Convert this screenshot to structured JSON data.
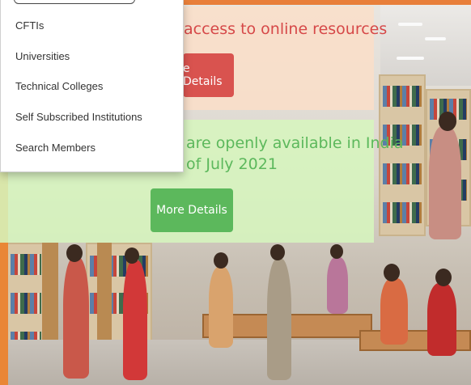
{
  "banners": [
    {
      "text": "access to online resources",
      "button_label": "e Details"
    },
    {
      "text_line1": "are openly available in India",
      "text_line2": "of July 2021",
      "button_label": "More Details"
    }
  ],
  "menu": {
    "items": [
      "CFTIs",
      "Universities",
      "Technical Colleges",
      "Self Subscribed Institutions",
      "Search Members"
    ]
  },
  "colors": {
    "accent_orange": "#e87f3a",
    "red_text": "#d64848",
    "red_button": "#d9534f",
    "green_text": "#5cb85c",
    "green_button": "#5cb85c"
  }
}
